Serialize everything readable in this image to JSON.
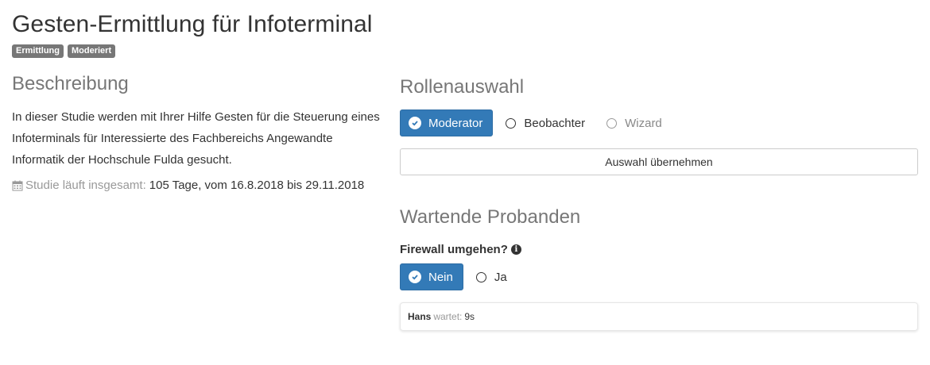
{
  "header": {
    "title": "Gesten-Ermittlung für Infoterminal",
    "badges": [
      "Ermittlung",
      "Moderiert"
    ]
  },
  "description": {
    "heading": "Beschreibung",
    "text": "In dieser Studie werden mit Ihrer Hilfe Gesten für die Steuerung eines Infoterminals für Interessierte des Fachbereichs Angewandte Informatik der Hochschule Fulda gesucht.",
    "duration_label": "Studie läuft insgesamt:",
    "duration_value": "105 Tage, vom 16.8.2018 bis 29.11.2018",
    "duration_icon": "calendar-icon"
  },
  "roles": {
    "heading": "Rollenauswahl",
    "options": [
      {
        "label": "Moderator",
        "selected": true,
        "disabled": false
      },
      {
        "label": "Beobachter",
        "selected": false,
        "disabled": false
      },
      {
        "label": "Wizard",
        "selected": false,
        "disabled": true
      }
    ],
    "apply_label": "Auswahl übernehmen"
  },
  "waiting": {
    "heading": "Wartende Probanden",
    "firewall_label": "Firewall umgehen?",
    "firewall_icon": "info-icon",
    "firewall_options": [
      {
        "label": "Nein",
        "selected": true
      },
      {
        "label": "Ja",
        "selected": false
      }
    ],
    "participants": [
      {
        "name": "Hans",
        "status_label": "wartet:",
        "time": "9s"
      }
    ]
  },
  "colors": {
    "primary": "#337ab7",
    "badge": "#777777",
    "muted": "#999999"
  }
}
